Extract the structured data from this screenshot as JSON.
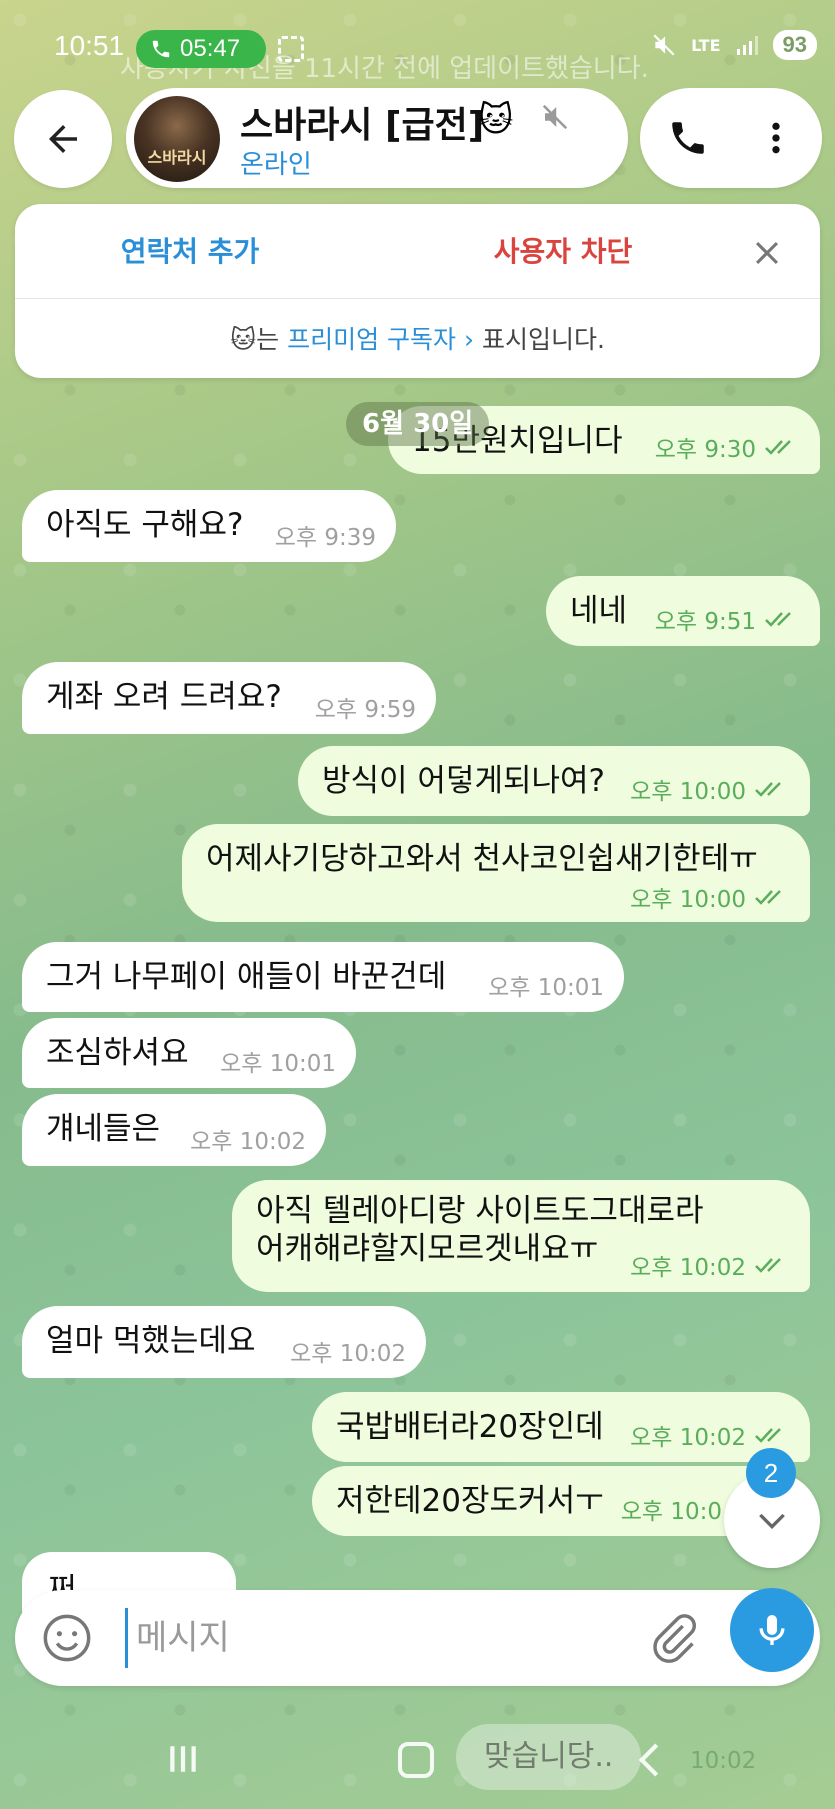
{
  "status_bar": {
    "time": "10:51",
    "call_timer": "05:47",
    "network": "LTE",
    "battery": "93"
  },
  "background_notice": "사용자가 사진을 11시간 전에 업데이트했습니다.",
  "header": {
    "title": "스바라시 [급전]",
    "title_emoji": "🐱",
    "status": "온라인",
    "avatar_text": "스바라시"
  },
  "action_panel": {
    "add_contact": "연락처 추가",
    "block_user": "사용자 차단",
    "premium_prefix": "는 ",
    "premium_link": "프리미엄 구독자 ›",
    "premium_suffix": " 표시입니다.",
    "premium_emoji": "🐱"
  },
  "date_chip": "6월 30일",
  "messages": [
    {
      "dir": "out",
      "text": "15만원치입니다",
      "time": "오후 9:30"
    },
    {
      "dir": "in",
      "text": "아직도 구해요?",
      "time": "오후 9:39"
    },
    {
      "dir": "out",
      "text": "네네",
      "time": "오후 9:51"
    },
    {
      "dir": "in",
      "text": "게좌 오려 드려요?",
      "time": "오후 9:59"
    },
    {
      "dir": "out",
      "text": "방식이 어덯게되나여?",
      "time": "오후 10:00"
    },
    {
      "dir": "out",
      "text": "어제사기당하고와서 천사코인쉽새기한테ㅠ",
      "time": "오후 10:00"
    },
    {
      "dir": "in",
      "text": "그거 나무페이 애들이 바꾼건데",
      "time": "오후 10:01"
    },
    {
      "dir": "in",
      "text": "조심하셔요",
      "time": "오후 10:01"
    },
    {
      "dir": "in",
      "text": "걔네들은",
      "time": "오후 10:02"
    },
    {
      "dir": "out",
      "text_line1": "아직 텔레아디랑 사이트도그대로라",
      "text_line2": "어캐해랴할지모르겟내요ㅠ",
      "time": "오후 10:02"
    },
    {
      "dir": "in",
      "text": "얼마 먹했는데요",
      "time": "오후 10:02"
    },
    {
      "dir": "out",
      "text": "국밥배터라20장인데",
      "time": "오후 10:02"
    },
    {
      "dir": "out",
      "text": "저한테20장도커서ㅜ",
      "time": "오후 10:0"
    },
    {
      "dir": "in",
      "text": "쩌"
    }
  ],
  "unread_count": "2",
  "input": {
    "placeholder": "메시지"
  },
  "ghost_reply": {
    "text": "맞습니당..",
    "time": "10:02"
  },
  "icons": {
    "back": "arrow-left-icon",
    "phone": "phone-icon",
    "more": "more-vertical-icon",
    "close": "close-icon",
    "emoji": "smile-icon",
    "attach": "paperclip-icon",
    "mic": "microphone-icon",
    "scroll_down": "chevron-down-icon"
  },
  "colors": {
    "accent": "#2a8fd6",
    "danger": "#d9443e",
    "outgoing_bubble": "#effdde",
    "incoming_bubble": "#ffffff",
    "read_check": "#5aad5a"
  }
}
